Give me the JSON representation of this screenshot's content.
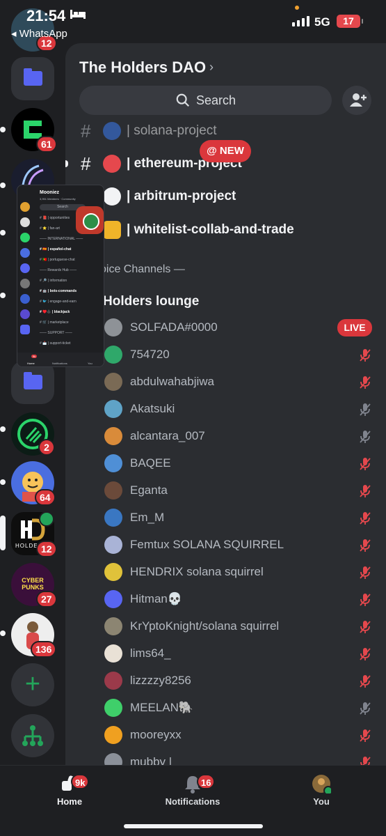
{
  "status_bar": {
    "time": "21:54",
    "back_app": "◂ WhatsApp",
    "network": "5G",
    "battery": "17"
  },
  "rail": {
    "badges": {
      "first": "12",
      "server2": "61",
      "eth": "2",
      "cartoon": "64",
      "holders": "12",
      "cyberpunks": "27",
      "avatar": "136"
    },
    "holders_label": "HOLDERS",
    "cyberpunks_label": "CYBER PUNKS"
  },
  "server": {
    "title": "The Holders DAO",
    "search_label": "Search"
  },
  "channels": [
    {
      "name": "| solana-project",
      "emoji_color": "#3b7cf4"
    },
    {
      "name": "| ethereum-project",
      "emoji_color": "#e5484d"
    },
    {
      "name": "| arbitrum-project",
      "emoji_color": "#f2f3f5"
    },
    {
      "name": "| whitelist-collab-and-trade",
      "emoji_color": "#f0b429"
    }
  ],
  "new_pill": "@ NEW",
  "voice": {
    "category": "oice Channels  —",
    "channel_name": "Holders lounge",
    "live_label": "LIVE"
  },
  "members": [
    {
      "name": "SOLFADA#0000",
      "color": "#8e9297",
      "state": "live"
    },
    {
      "name": "754720",
      "color": "#2fa86a",
      "state": "muted"
    },
    {
      "name": "abdulwahabjiwa",
      "color": "#7a6a55",
      "state": "muted"
    },
    {
      "name": "Akatsuki",
      "color": "#5fa3c7",
      "state": "off"
    },
    {
      "name": "alcantara_007",
      "color": "#d98b3a",
      "state": "off"
    },
    {
      "name": "BAQEE",
      "color": "#4f8fd6",
      "state": "muted"
    },
    {
      "name": "Eganta",
      "color": "#6b4a3a",
      "state": "muted"
    },
    {
      "name": "Em_M",
      "color": "#3a77c2",
      "state": "muted"
    },
    {
      "name": "Femtux SOLANA SQUIRREL",
      "color": "#a9b3d6",
      "state": "muted"
    },
    {
      "name": "HENDRIX solana squirrel",
      "color": "#e0c23a",
      "state": "muted"
    },
    {
      "name": "Hitman💀",
      "color": "#5865f2",
      "state": "muted"
    },
    {
      "name": "KrYptoKnight/solana squirrel",
      "color": "#8c8572",
      "state": "muted"
    },
    {
      "name": "lims64_",
      "color": "#e9e1d6",
      "state": "muted"
    },
    {
      "name": "lizzzzy8256",
      "color": "#9b3a4a",
      "state": "muted"
    },
    {
      "name": "MEELAN🐘",
      "color": "#3fcf6a",
      "state": "off"
    },
    {
      "name": "mooreyxx",
      "color": "#f0a020",
      "state": "muted"
    },
    {
      "name": "mubby |",
      "color": "#8b9099",
      "state": "muted"
    }
  ],
  "mini_preview": {
    "title": "Mooniez",
    "subtitle": "3,951 Members · Community",
    "search": "Search",
    "rows": [
      {
        "text": "# 📕 | opportunities",
        "bold": false
      },
      {
        "text": "# ⭐ | fan-art",
        "bold": false
      },
      {
        "text": "—— INTERNATIONAL ——",
        "bold": false
      },
      {
        "text": "# 🇪🇸 | español-chat",
        "bold": true
      },
      {
        "text": "# 🇵🇹 | portuguese-chat",
        "bold": false
      },
      {
        "text": "—— Rewards Hub ——",
        "bold": false
      },
      {
        "text": "# 🔎 | information",
        "bold": false
      },
      {
        "text": "# 🤖 | bots-commands",
        "bold": true
      },
      {
        "text": "# 🐦 | engage-and-earn",
        "bold": false
      },
      {
        "text": "# ♥️♣️ | blackjack",
        "bold": true
      },
      {
        "text": "# 🛒 | marketplace",
        "bold": false
      },
      {
        "text": "—— SUPPORT ——",
        "bold": false
      },
      {
        "text": "# 📩 | support-ticket",
        "bold": false
      }
    ],
    "tabs": {
      "home": "Home",
      "notifications": "Notifications",
      "you": "You",
      "home_badge": "9k"
    }
  },
  "tabbar": {
    "home": {
      "label": "Home",
      "badge": "9k"
    },
    "notifications": {
      "label": "Notifications",
      "badge": "16"
    },
    "you": {
      "label": "You"
    }
  }
}
